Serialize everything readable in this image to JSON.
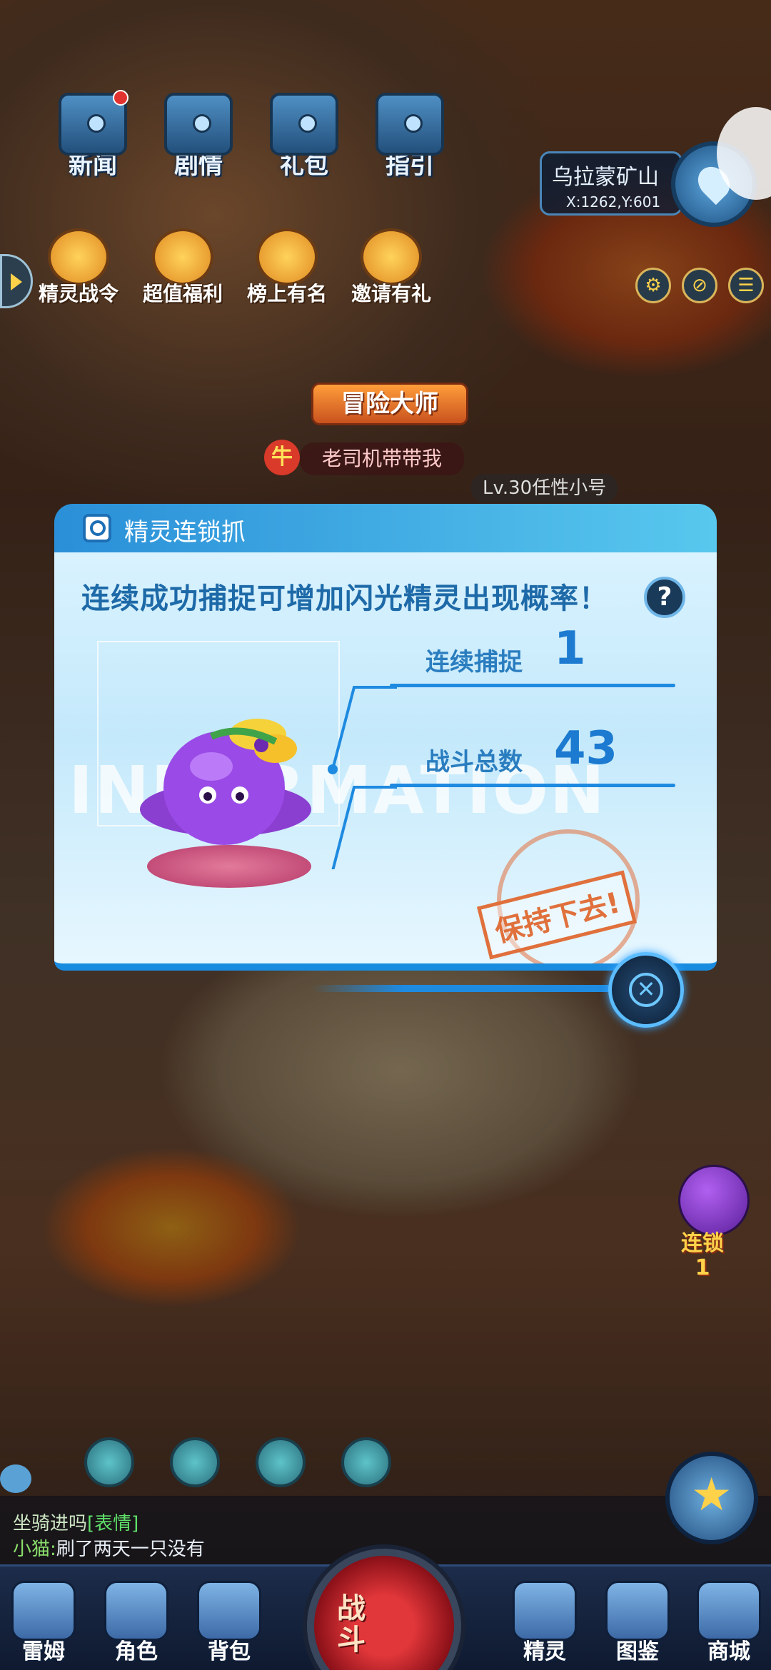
{
  "top_menu": [
    {
      "label": "新闻",
      "icon": "newspaper-chest-icon",
      "has_dot": true
    },
    {
      "label": "剧情",
      "icon": "story-chest-icon",
      "has_dot": false
    },
    {
      "label": "礼包",
      "icon": "gift-chest-icon",
      "has_dot": false
    },
    {
      "label": "指引",
      "icon": "guide-chest-icon",
      "has_dot": false
    }
  ],
  "activity_menu": [
    {
      "label": "精灵战令",
      "icon": "battle-pass-icon"
    },
    {
      "label": "超值福利",
      "icon": "welfare-gift-icon"
    },
    {
      "label": "榜上有名",
      "icon": "trophy-icon"
    },
    {
      "label": "邀请有礼",
      "icon": "invite-gift-icon"
    }
  ],
  "map": {
    "name": "乌拉蒙矿山",
    "coords": "X:1262,Y:601"
  },
  "npc": {
    "plaque": "冒险大师",
    "badge": "牛",
    "name": "老司机带带我",
    "level": "Lv.30任性小号"
  },
  "dialog": {
    "title": "精灵连锁抓",
    "tagline": "连续成功捕捉可增加闪光精灵出现概率！",
    "help": "?",
    "watermark": "INFORMATION",
    "streak_label": "连续捕捉",
    "streak_value": "1",
    "battles_label": "战斗总数",
    "battles_value": "43",
    "stamp": "保持下去!"
  },
  "side_indicator": {
    "label": "连锁",
    "value": "1"
  },
  "chat": {
    "line1_text": "坐骑进吗",
    "line1_emote": "[表情]",
    "line2_user": "小猫:",
    "line2_msg": "刷了两天一只没有"
  },
  "bottom_nav": [
    {
      "label": "雷姆",
      "icon": "pet-avatar-icon"
    },
    {
      "label": "角色",
      "icon": "character-icon"
    },
    {
      "label": "背包",
      "icon": "backpack-icon"
    },
    {
      "label": "精灵",
      "icon": "spirit-icon"
    },
    {
      "label": "图鉴",
      "icon": "handbook-icon"
    },
    {
      "label": "商城",
      "icon": "shop-icon"
    }
  ],
  "fight_label": "战斗",
  "colors": {
    "accent": "#1e8ae0",
    "dialog_bg": "#d9f2ff",
    "stamp": "#e0703c",
    "fight": "#e2373a"
  }
}
